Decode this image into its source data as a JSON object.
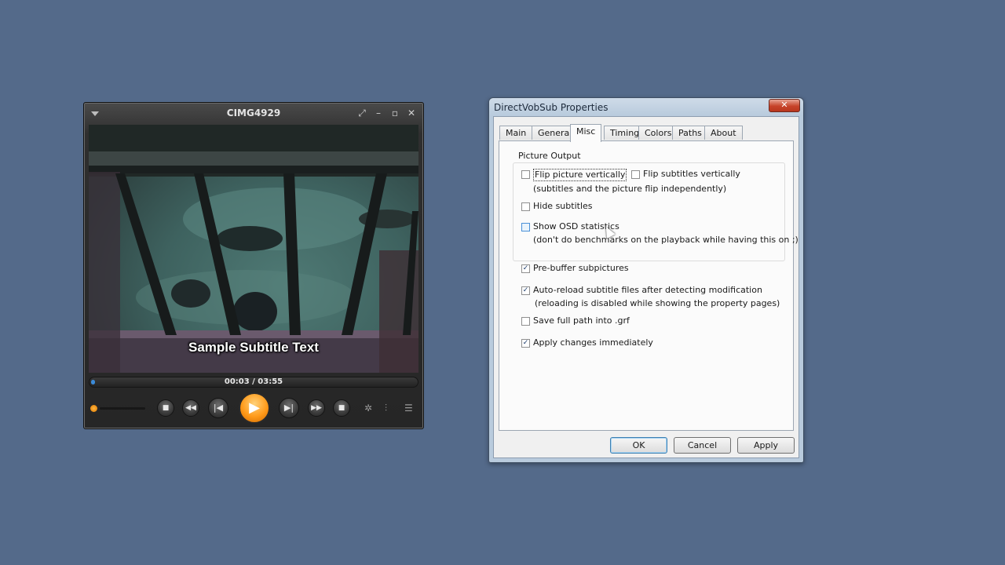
{
  "player": {
    "title": "CIMG4929",
    "subtitle_text": "Sample Subtitle Text",
    "time": "00:03 / 03:55",
    "progress": 0.013
  },
  "dialog": {
    "title": "DirectVobSub Properties",
    "close_glyph": "✕",
    "tabs": [
      {
        "label": "Main"
      },
      {
        "label": "General"
      },
      {
        "label": "Misc"
      },
      {
        "label": "Timing"
      },
      {
        "label": "Colors"
      },
      {
        "label": "Paths"
      },
      {
        "label": "About"
      }
    ],
    "active_tab": "Misc",
    "group_title": "Picture Output",
    "options": {
      "flip_picture": {
        "label": "Flip picture vertically",
        "checked": false
      },
      "flip_subtitles": {
        "label": "Flip subtitles vertically",
        "checked": false
      },
      "flip_note": "(subtitles and the picture flip independently)",
      "hide_subtitles": {
        "label": "Hide subtitles",
        "checked": false
      },
      "show_osd": {
        "label": "Show OSD statistics",
        "checked": false
      },
      "osd_note": "(don't do benchmarks on the playback while having this on ;)",
      "prebuffer": {
        "label": "Pre-buffer subpictures",
        "checked": true
      },
      "autoreload": {
        "label": "Auto-reload subtitle files after detecting modification",
        "checked": true
      },
      "autoreload_note": "(reloading is disabled while showing the property pages)",
      "save_path": {
        "label": "Save full path into .grf",
        "checked": false
      },
      "apply_immediately": {
        "label": "Apply changes immediately",
        "checked": true
      }
    },
    "buttons": {
      "ok": "OK",
      "cancel": "Cancel",
      "apply": "Apply"
    }
  },
  "colors": {
    "desktop": "#546a8a",
    "accent_orange": "#ff9a1a"
  }
}
